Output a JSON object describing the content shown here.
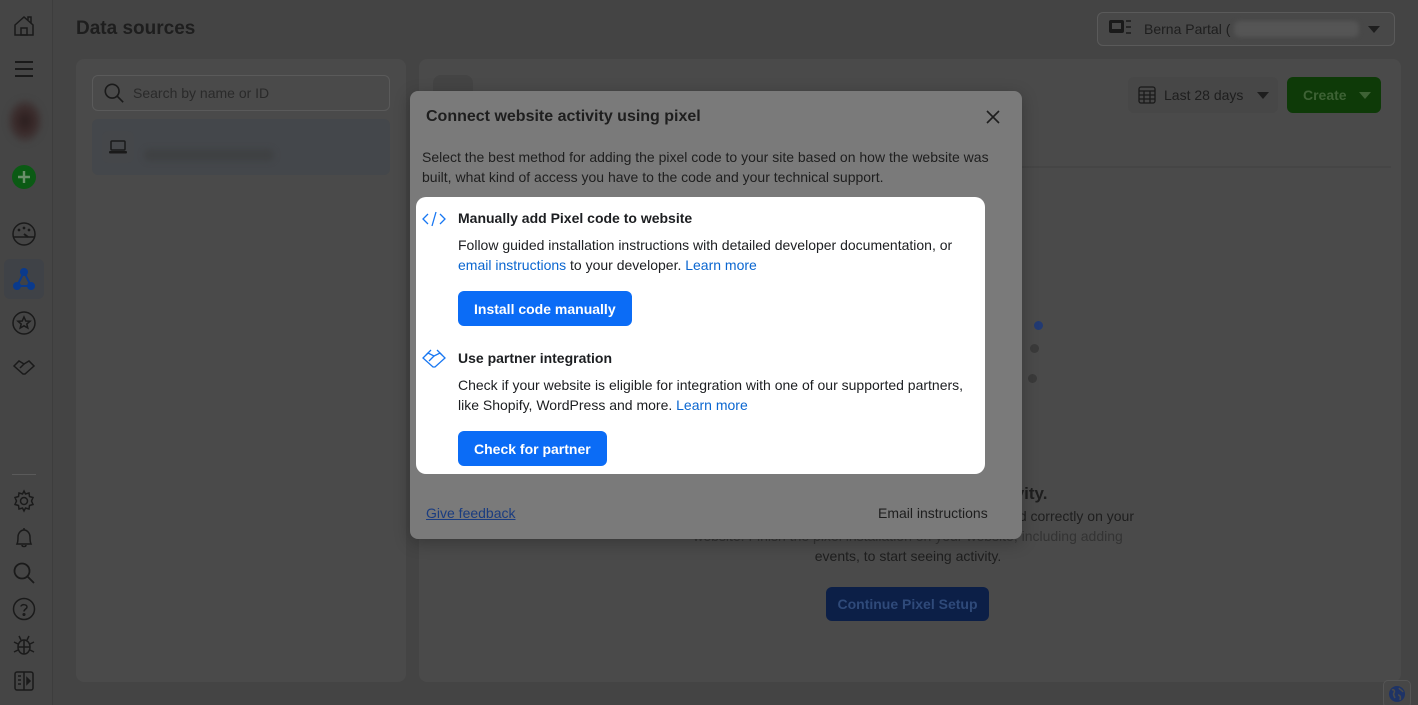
{
  "rail": {
    "items": [
      {
        "name": "home",
        "icon": "home-icon"
      },
      {
        "name": "menu",
        "icon": "menu-icon"
      },
      {
        "name": "account-avatar",
        "icon": "avatar"
      },
      {
        "name": "create",
        "icon": "plus-circle-icon"
      },
      {
        "name": "overview",
        "icon": "gauge-icon"
      },
      {
        "name": "data-sources",
        "icon": "network-icon",
        "active": true
      },
      {
        "name": "favorites",
        "icon": "star-icon"
      },
      {
        "name": "partner-integrations",
        "icon": "handshake-icon"
      },
      {
        "name": "settings",
        "icon": "gear-icon"
      },
      {
        "name": "notifications",
        "icon": "bell-icon"
      },
      {
        "name": "search",
        "icon": "search-icon"
      },
      {
        "name": "help",
        "icon": "help-icon"
      },
      {
        "name": "report-bug",
        "icon": "bug-icon"
      },
      {
        "name": "toggle-sidebar",
        "icon": "panel-icon"
      }
    ],
    "accent": "#0a3a8c",
    "create_color": "#0b5a14"
  },
  "header": {
    "title": "Data sources",
    "account_name": "Berna Partal ("
  },
  "left_panel": {
    "search_placeholder": "Search by name or ID"
  },
  "right_panel": {
    "date_range": "Last 28 days",
    "create_label": "Create",
    "empty_heading": "ivity.",
    "empty_text_line1": "d correctly on your",
    "empty_text_line2": "website. Finish the pixel installation on your website, including adding",
    "empty_text_line3": "events, to start seeing activity.",
    "continue_label": "Continue Pixel Setup"
  },
  "modal": {
    "title": "Connect website activity using pixel",
    "description": "Select the best method for adding the pixel code to your site based on how the website was built, what kind of access you have to the code and your technical support.",
    "options": [
      {
        "icon": "code-icon",
        "title": "Manually add Pixel code to website",
        "text_before": "Follow guided installation instructions with detailed developer documentation, or ",
        "link1": "email instructions",
        "text_middle": " to your developer. ",
        "link2": "Learn more",
        "button": "Install code manually"
      },
      {
        "icon": "handshake-icon",
        "title": "Use partner integration",
        "text_before": "Check if your website is eligible for integration with one of our supported partners, like Shopify, WordPress and more. ",
        "link2": "Learn more",
        "button": "Check for partner"
      }
    ],
    "feedback_label": "Give feedback",
    "email_label": "Email instructions",
    "primary_color": "#0b6cf6",
    "link_color": "#0a66d0"
  }
}
